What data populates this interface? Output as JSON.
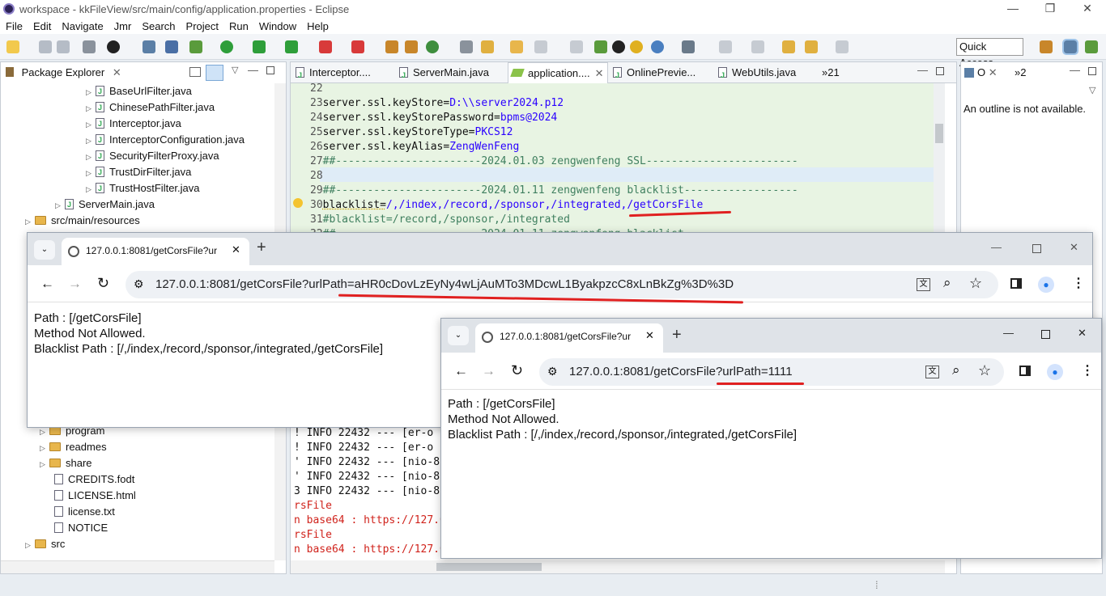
{
  "window": {
    "title": "workspace - kkFileView/src/main/config/application.properties - Eclipse",
    "minimize": "—",
    "restore": "❐",
    "close": "✕"
  },
  "menu": [
    "File",
    "Edit",
    "Navigate",
    "Jmr",
    "Search",
    "Project",
    "Run",
    "Window",
    "Help"
  ],
  "quick_access": "Quick Access",
  "package_explorer": {
    "title": "Package Explorer",
    "items": [
      {
        "label": "BaseUrlFilter.java",
        "kind": "java"
      },
      {
        "label": "ChinesePathFilter.java",
        "kind": "java"
      },
      {
        "label": "Interceptor.java",
        "kind": "java"
      },
      {
        "label": "InterceptorConfiguration.java",
        "kind": "java"
      },
      {
        "label": "SecurityFilterProxy.java",
        "kind": "java"
      },
      {
        "label": "TrustDirFilter.java",
        "kind": "java"
      },
      {
        "label": "TrustHostFilter.java",
        "kind": "java"
      },
      {
        "label": "ServerMain.java",
        "kind": "java"
      },
      {
        "label": "src/main/resources",
        "kind": "folder"
      }
    ],
    "items_lower": [
      {
        "label": "program",
        "kind": "folder"
      },
      {
        "label": "readmes",
        "kind": "folder"
      },
      {
        "label": "share",
        "kind": "folder"
      },
      {
        "label": "CREDITS.fodt",
        "kind": "file"
      },
      {
        "label": "LICENSE.html",
        "kind": "file"
      },
      {
        "label": "license.txt",
        "kind": "file"
      },
      {
        "label": "NOTICE",
        "kind": "file"
      },
      {
        "label": "src",
        "kind": "folder"
      }
    ]
  },
  "editor": {
    "tabs": [
      "Interceptor....",
      "ServerMain.java",
      "application....",
      "OnlinePrevie...",
      "WebUtils.java",
      "»21"
    ],
    "lines": [
      {
        "n": "22",
        "key": "",
        "val": ""
      },
      {
        "n": "23",
        "key": "server.ssl.keyStore=",
        "val": "D:\\\\server2024.p12"
      },
      {
        "n": "24",
        "key": "server.ssl.keyStorePassword=",
        "val": "bpms@2024"
      },
      {
        "n": "25",
        "key": "server.ssl.keyStoreType=",
        "val": "PKCS12"
      },
      {
        "n": "26",
        "key": "server.ssl.keyAlias=",
        "val": "ZengWenFeng"
      },
      {
        "n": "27",
        "key": "",
        "val": "",
        "comment": "##-----------------------2024.01.03 zengwenfeng SSL------------------------"
      },
      {
        "n": "28",
        "key": "",
        "val": ""
      },
      {
        "n": "29",
        "key": "",
        "val": "",
        "comment": "##-----------------------2024.01.11 zengwenfeng blacklist------------------"
      },
      {
        "n": "30",
        "key": "blacklist=",
        "val": "/,/index,/record,/sponsor,/integrated,/getCorsFile"
      },
      {
        "n": "31",
        "key": "",
        "val": "",
        "comment": "#blacklist=/record,/sponsor,/integrated"
      },
      {
        "n": "32",
        "key": "",
        "val": "",
        "comment": "##-----------------------2024.01.11 zengwenfeng blacklist"
      }
    ]
  },
  "outline": {
    "tab": "O",
    "extra": "»2",
    "message": "An outline is not available."
  },
  "console": {
    "lines": [
      {
        "pre": "!",
        "text": " INFO 22432 --- [er-o"
      },
      {
        "pre": "!",
        "text": " INFO 22432 --- [er-o"
      },
      {
        "pre": "'",
        "text": " INFO 22432 --- [nio-8"
      },
      {
        "pre": "'",
        "text": " INFO 22432 --- [nio-8"
      },
      {
        "pre": "3",
        "text": " INFO 22432 --- [nio-8"
      }
    ],
    "red_lines": [
      "rsFile",
      "n base64 : https://127.0",
      "rsFile",
      "n base64 : https://127.0"
    ]
  },
  "browser1": {
    "tab_title": "127.0.0.1:8081/getCorsFile?ur",
    "url": "127.0.0.1:8081/getCorsFile?urlPath=aHR0cDovLzEyNy4wLjAuMTo3MDcwL1ByakpzcC8xLnBkZg%3D%3D",
    "content": [
      "Path : [/getCorsFile]",
      "Method Not Allowed.",
      "Blacklist Path : [/,/index,/record,/sponsor,/integrated,/getCorsFile]"
    ]
  },
  "browser2": {
    "tab_title": "127.0.0.1:8081/getCorsFile?ur",
    "url": "127.0.0.1:8081/getCorsFile?urlPath=1111",
    "content": [
      "Path : [/getCorsFile]",
      "Method Not Allowed.",
      "Blacklist Path : [/,/index,/record,/sponsor,/integrated,/getCorsFile]"
    ]
  },
  "colors": {
    "accent": "#1a73e8",
    "annotation": "#e02020",
    "editor_bg": "#e8f4e3"
  }
}
